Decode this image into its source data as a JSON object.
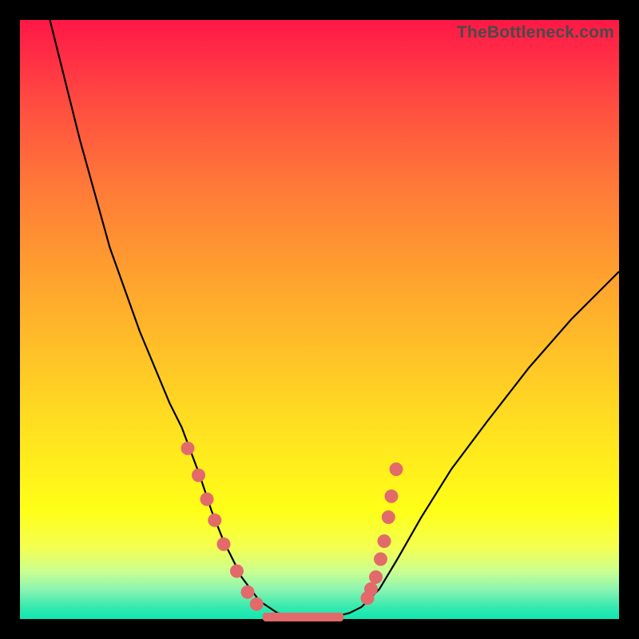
{
  "watermark": "TheBottleneck.com",
  "chart_data": {
    "type": "line",
    "title": "",
    "xlabel": "",
    "ylabel": "",
    "xlim": [
      0,
      100
    ],
    "ylim": [
      0,
      100
    ],
    "series": [
      {
        "name": "bottleneck-curve",
        "x": [
          5,
          10,
          15,
          20,
          25,
          27,
          30,
          32,
          34,
          37,
          40,
          43,
          45,
          47,
          50,
          53,
          55,
          57,
          60,
          63,
          67,
          72,
          78,
          85,
          92,
          100
        ],
        "y": [
          100,
          80,
          62,
          48,
          36,
          32,
          24,
          18,
          13,
          7,
          3,
          1,
          0.5,
          0.4,
          0.4,
          0.5,
          1,
          2,
          5,
          10,
          17,
          25,
          33,
          42,
          50,
          58
        ]
      }
    ],
    "markers_left": {
      "name": "left-cluster",
      "color": "#e36a6a",
      "x": [
        28.0,
        29.8,
        31.2,
        32.5,
        34.0,
        36.2,
        38.0,
        39.5
      ],
      "y": [
        28.5,
        24.0,
        20.0,
        16.5,
        12.5,
        8.0,
        4.5,
        2.5
      ]
    },
    "markers_right": {
      "name": "right-cluster",
      "color": "#e36a6a",
      "x": [
        58.0,
        58.6,
        59.4,
        60.2,
        60.8,
        61.5,
        62.0,
        62.8
      ],
      "y": [
        3.5,
        5.0,
        7.0,
        10.0,
        13.0,
        17.0,
        20.5,
        25.0
      ]
    },
    "flat_segment": {
      "name": "bottom-bar",
      "color": "#e36a6a",
      "x_start": 40.5,
      "x_end": 54.0,
      "y": 0.4
    },
    "colors": {
      "curve": "#000000",
      "marker": "#e36a6a",
      "gradient_top": "#ff1846",
      "gradient_bottom": "#0ee8b0"
    }
  }
}
